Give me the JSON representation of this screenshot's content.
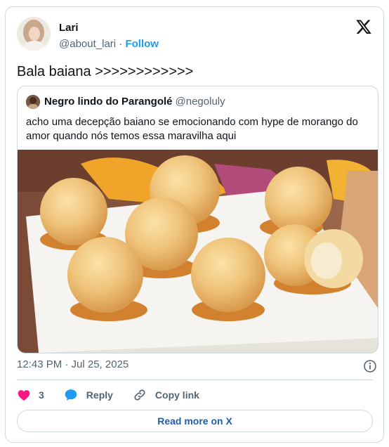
{
  "author": {
    "name": "Lari",
    "handle": "@about_lari",
    "separator": "·",
    "follow_label": "Follow"
  },
  "tweet": {
    "text": "Bala baiana >>>>>>>>>>>>",
    "timestamp": "12:43 PM · Jul 25, 2025"
  },
  "quoted": {
    "name": "Negro lindo do Parangolé",
    "handle": "@negoluly",
    "text": "acho uma decepção baiano se emocionando com hype de morango do amor quando nós temos essa maravilha aqui"
  },
  "actions": {
    "likes_count": "3",
    "reply_label": "Reply",
    "copy_label": "Copy link"
  },
  "footer": {
    "read_more_label": "Read more on X"
  },
  "icons": {
    "like": "heart-icon",
    "reply": "speech-bubble-icon",
    "copy": "link-icon",
    "info": "info-icon",
    "logo": "x-logo-icon"
  },
  "colors": {
    "like": "#f91880",
    "reply": "#1d9bf0",
    "link": "#1d9bf0",
    "text_secondary": "#536471",
    "border": "#cfd9de"
  }
}
